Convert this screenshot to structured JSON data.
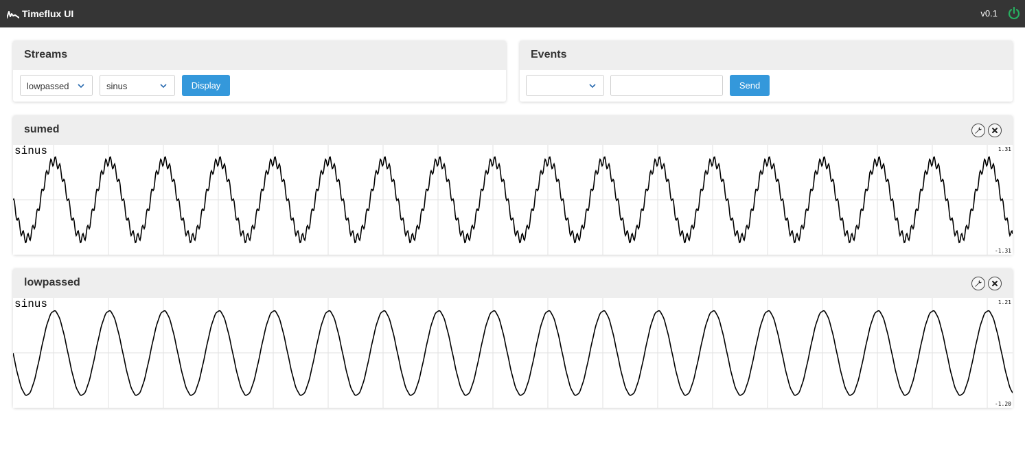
{
  "app": {
    "title": "Timeflux UI",
    "version": "v0.1",
    "power_color": "#27ae60"
  },
  "streams": {
    "title": "Streams",
    "stream_select": {
      "selected": "lowpassed"
    },
    "channel_select": {
      "selected": "sinus"
    },
    "display_label": "Display"
  },
  "events": {
    "title": "Events",
    "event_select": {
      "selected": ""
    },
    "event_input": {
      "value": "",
      "placeholder": ""
    },
    "send_label": "Send"
  },
  "accent_color": "#3498db",
  "panels": [
    {
      "title": "sumed",
      "series_label": "sinus",
      "ymax": "1.31",
      "ymin": "-1.31"
    },
    {
      "title": "lowpassed",
      "series_label": "sinus",
      "ymax": "1.21",
      "ymin": "-1.20"
    }
  ],
  "chart_data": [
    {
      "type": "line",
      "series": [
        {
          "name": "sinus",
          "cycles": 18.2,
          "amplitude": 1.0,
          "noise_amplitude": 0.12,
          "noise_ratio": 12
        }
      ],
      "ylim": [
        -1.31,
        1.31
      ],
      "grid": true
    },
    {
      "type": "line",
      "series": [
        {
          "name": "sinus",
          "cycles": 18.2,
          "amplitude": 1.0,
          "noise_amplitude": 0.008,
          "noise_ratio": 12
        }
      ],
      "ylim": [
        -1.2,
        1.21
      ],
      "grid": true
    }
  ]
}
